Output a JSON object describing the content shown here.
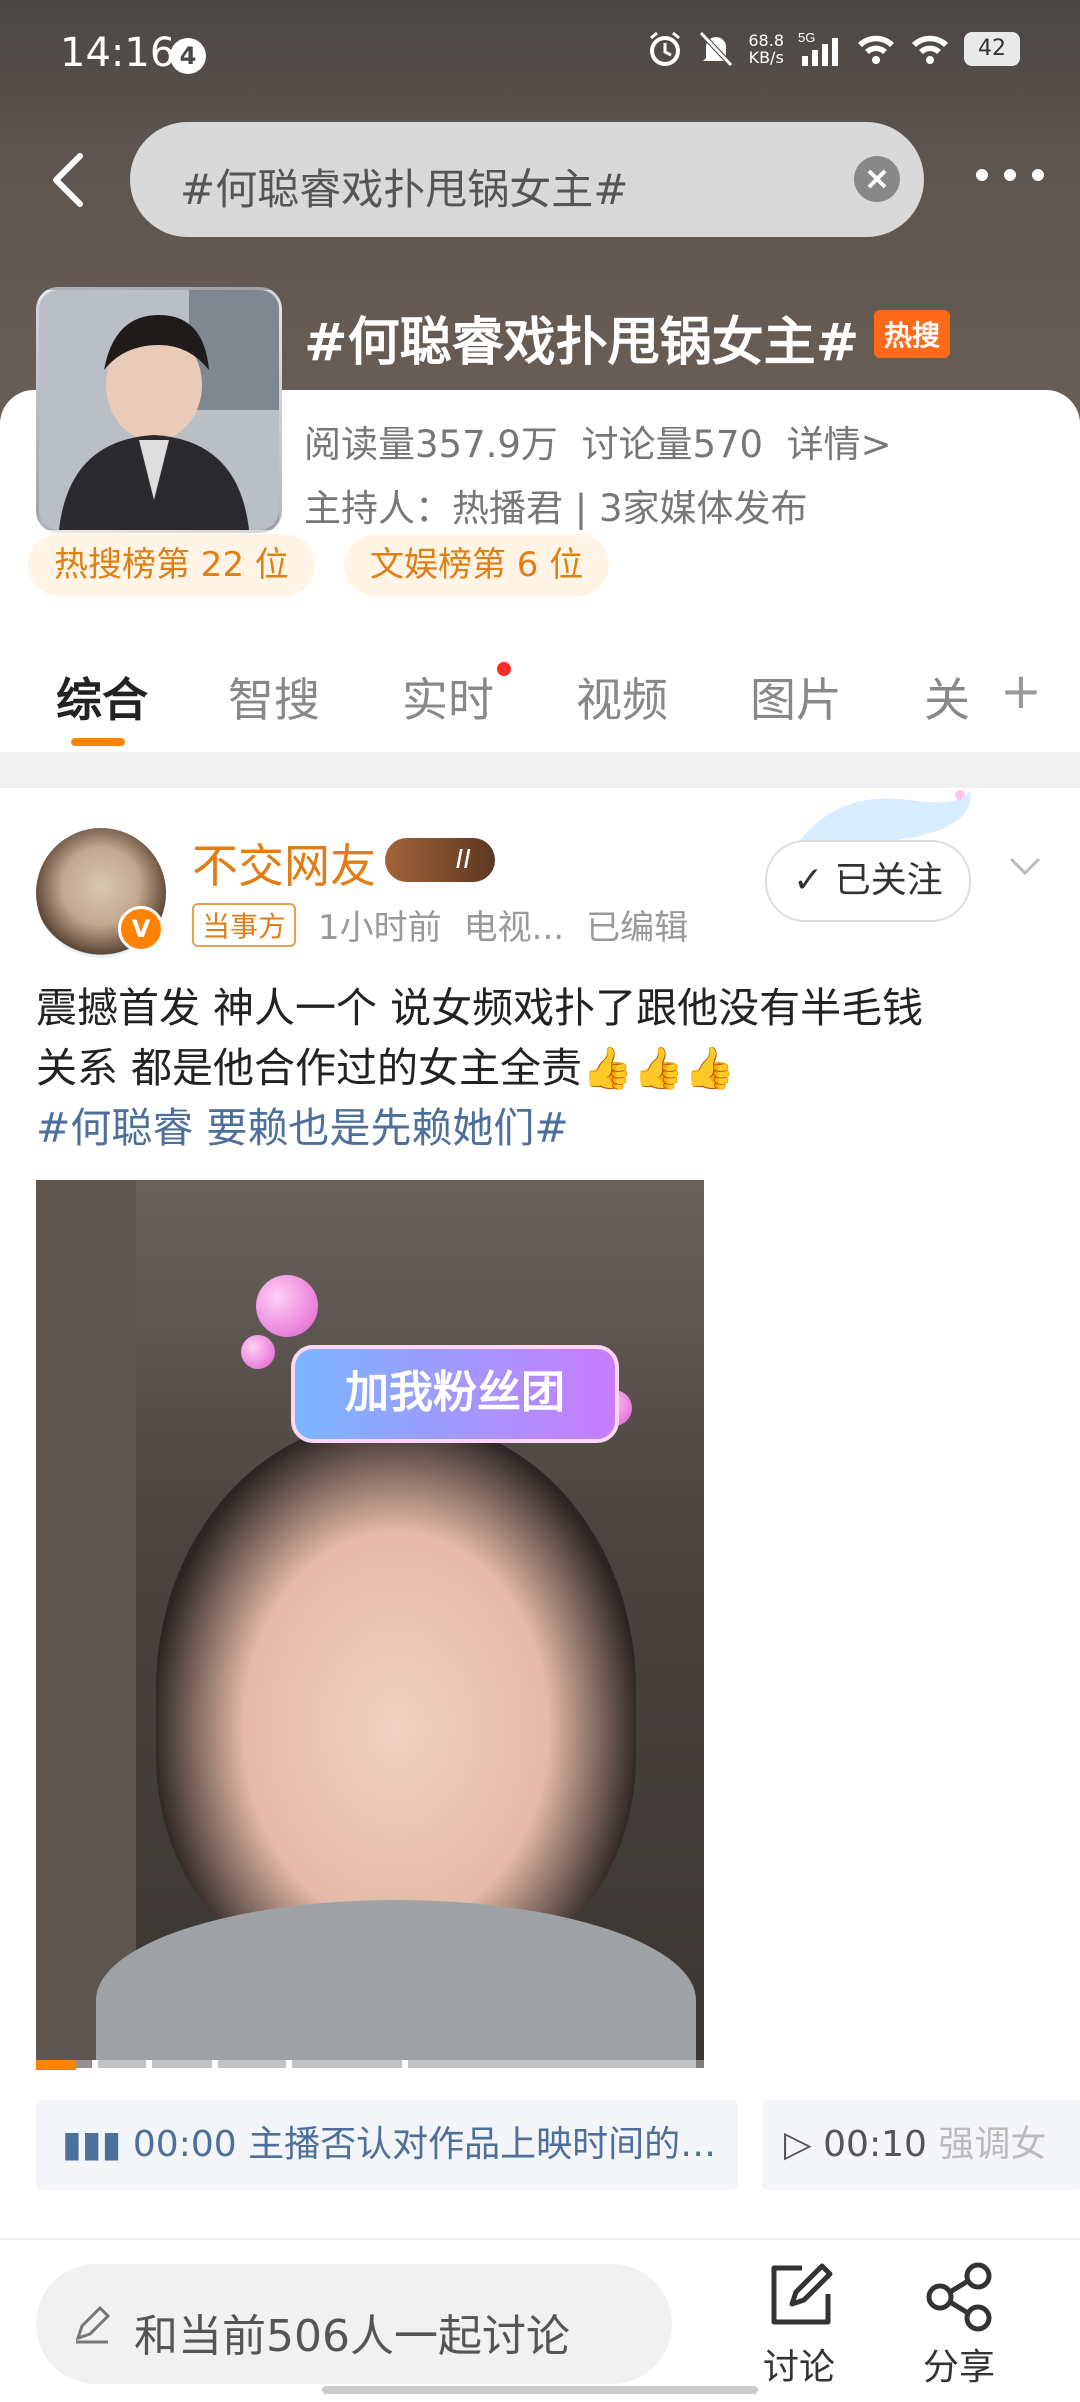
{
  "status_bar": {
    "time": "14:16",
    "notification_count": "4",
    "net_speed_value": "68.8",
    "net_speed_unit": "KB/s",
    "network": "5G",
    "battery": "42"
  },
  "search": {
    "query": "#何聪睿戏扑甩锅女主#"
  },
  "topic": {
    "title": "#何聪睿戏扑甩锅女主#",
    "hot_badge": "热搜",
    "stats": "阅读量357.9万  讨论量570  详情>",
    "host": "主持人：热播君 | 3家媒体发布",
    "ranks": [
      "热搜榜第 22 位",
      "文娱榜第 6 位"
    ]
  },
  "tabs": [
    {
      "label": "综合",
      "active": true
    },
    {
      "label": "智搜",
      "active": false
    },
    {
      "label": "实时",
      "active": false,
      "dot": true
    },
    {
      "label": "视频",
      "active": false
    },
    {
      "label": "图片",
      "active": false
    },
    {
      "label": "关",
      "active": false
    }
  ],
  "post": {
    "author": "不交网友",
    "level": "II",
    "tag": "当事方",
    "time": "1小时前",
    "source": "电视...",
    "edited": "已编辑",
    "follow_label": "已关注",
    "text_line1": "震撼首发 神人一个 说女频戏扑了跟他没有半毛钱",
    "text_line2": "关系 都是他合作过的女主全责👍👍👍",
    "hashtag": "#何聪睿 要赖也是先赖她们#",
    "video_overlay": "加我粉丝团",
    "video_progress": 0.06,
    "chapters": [
      {
        "time": "00:00",
        "title": "主播否认对作品上映时间的…"
      },
      {
        "time": "00:10",
        "title": "强调女"
      }
    ]
  },
  "bottom_bar": {
    "comment_placeholder": "和当前506人一起讨论",
    "discuss_label": "讨论",
    "share_label": "分享"
  },
  "colors": {
    "accent": "#ff8200",
    "hashtag": "#4d6f9c",
    "hot_badge": "#ff6b1a"
  }
}
